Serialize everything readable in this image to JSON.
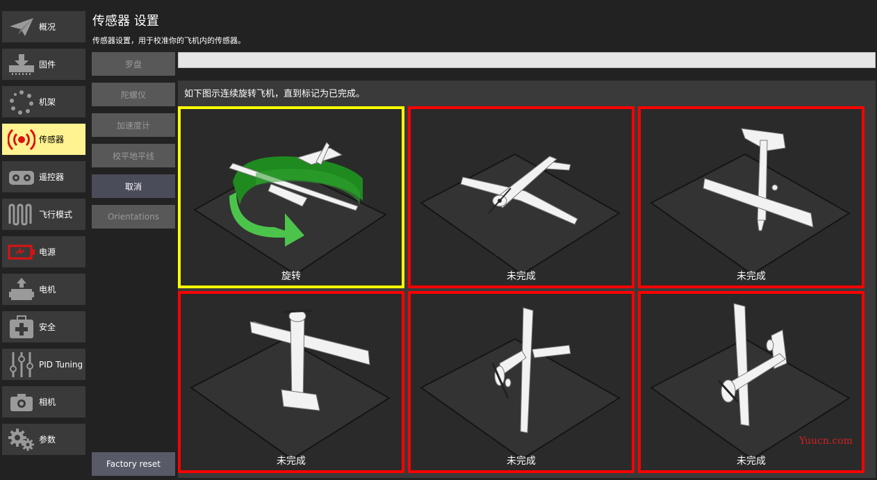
{
  "nav": {
    "items": [
      {
        "label": "概况",
        "icon": "paper-plane-icon",
        "active": false
      },
      {
        "label": "固件",
        "icon": "download-icon",
        "active": false
      },
      {
        "label": "机架",
        "icon": "airframe-dots-icon",
        "active": false
      },
      {
        "label": "传感器",
        "icon": "radio-waves-icon",
        "active": true
      },
      {
        "label": "遥控器",
        "icon": "remote-control-icon",
        "active": false
      },
      {
        "label": "飞行模式",
        "icon": "waveform-icon",
        "active": false
      },
      {
        "label": "电源",
        "icon": "battery-icon",
        "active": false
      },
      {
        "label": "电机",
        "icon": "motor-icon",
        "active": false
      },
      {
        "label": "安全",
        "icon": "first-aid-icon",
        "active": false
      },
      {
        "label": "PID Tuning",
        "icon": "sliders-icon",
        "active": false
      },
      {
        "label": "相机",
        "icon": "camera-icon",
        "active": false
      },
      {
        "label": "参数",
        "icon": "gears-icon",
        "active": false
      }
    ]
  },
  "header": {
    "title": "传感器 设置",
    "subtitle": "传感器设置，用于校准你的飞机内的传感器。"
  },
  "sensor_buttons": {
    "compass": "罗盘",
    "gyro": "陀螺仪",
    "accel": "加速度计",
    "level": "校平地平线",
    "cancel": "取消",
    "orientations": "Orientations",
    "factory_reset": "Factory reset"
  },
  "calibration": {
    "instruction": "如下图示连续旋转飞机，直到标记为已完成。",
    "tiles": [
      {
        "status": "旋转",
        "state": "rotating"
      },
      {
        "status": "未完成",
        "state": "incomplete"
      },
      {
        "status": "未完成",
        "state": "incomplete"
      },
      {
        "status": "未完成",
        "state": "incomplete"
      },
      {
        "status": "未完成",
        "state": "incomplete"
      },
      {
        "status": "未完成",
        "state": "incomplete"
      }
    ]
  },
  "colors": {
    "active_nav": "#fff291",
    "rotating_border": "#ffff00",
    "incomplete_border": "#ff0000"
  },
  "watermark": "Yuucn.com"
}
